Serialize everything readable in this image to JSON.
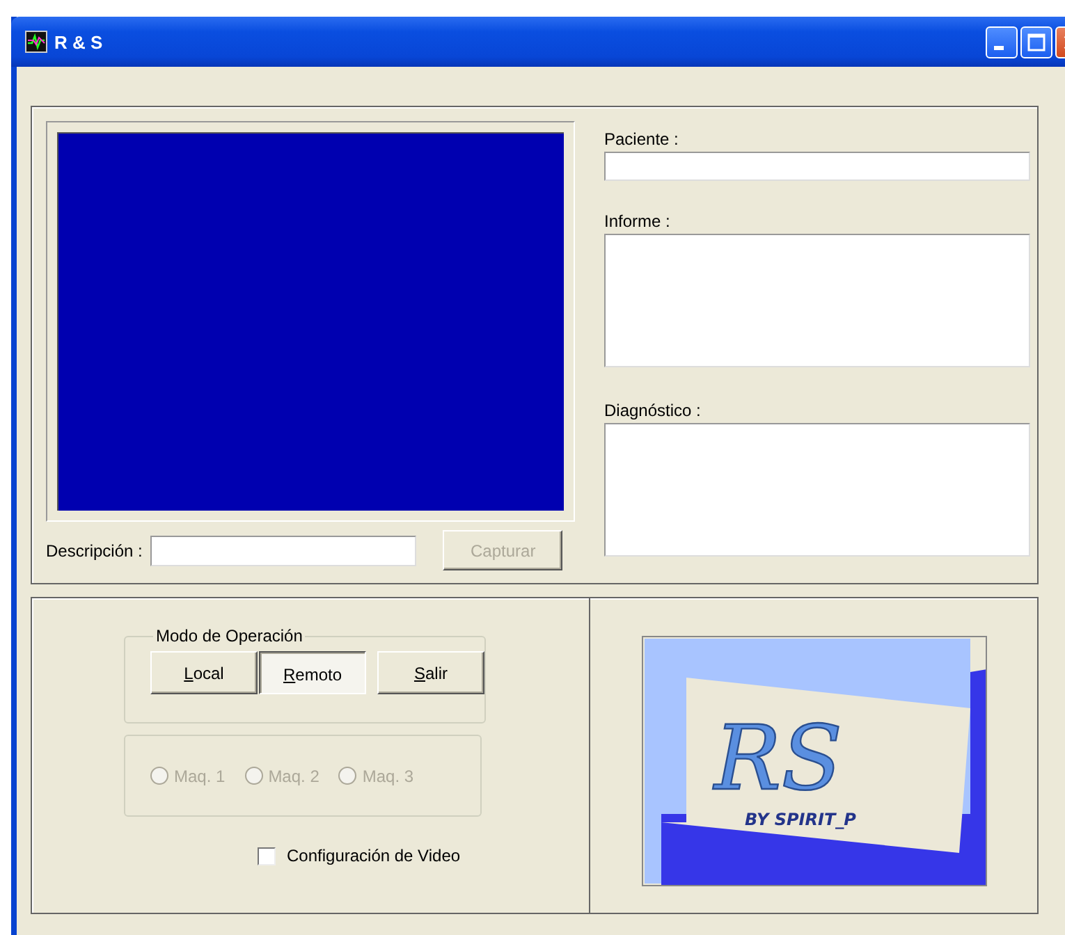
{
  "window": {
    "title": "R & S",
    "controls": [
      {
        "kind": "minimize"
      },
      {
        "kind": "maximize"
      },
      {
        "kind": "close"
      }
    ]
  },
  "fields": [
    {
      "label": "Paciente :",
      "kind": "line"
    },
    {
      "label": "Informe :",
      "kind": "area"
    },
    {
      "label": "Diagnóstico :",
      "kind": "area"
    }
  ],
  "description": {
    "label": "Descripción :"
  },
  "capture_button": {
    "label": "Capturar",
    "disabled": true
  },
  "mode_group": {
    "title": "Modo de Operación",
    "buttons": [
      {
        "label": "Local",
        "selected": false
      },
      {
        "label": "Remoto",
        "selected": true
      },
      {
        "label": "Salir",
        "selected": false
      }
    ]
  },
  "machines": [
    {
      "label": "Maq. 1",
      "checked": false,
      "disabled": true
    },
    {
      "label": "Maq. 2",
      "checked": false,
      "disabled": true
    },
    {
      "label": "Maq. 3",
      "checked": false,
      "disabled": true
    }
  ],
  "video_config": {
    "label": "Configuración de Video",
    "checked": false
  },
  "logo": {
    "title": "RS",
    "subtitle": "BY SPIRIT_P"
  }
}
